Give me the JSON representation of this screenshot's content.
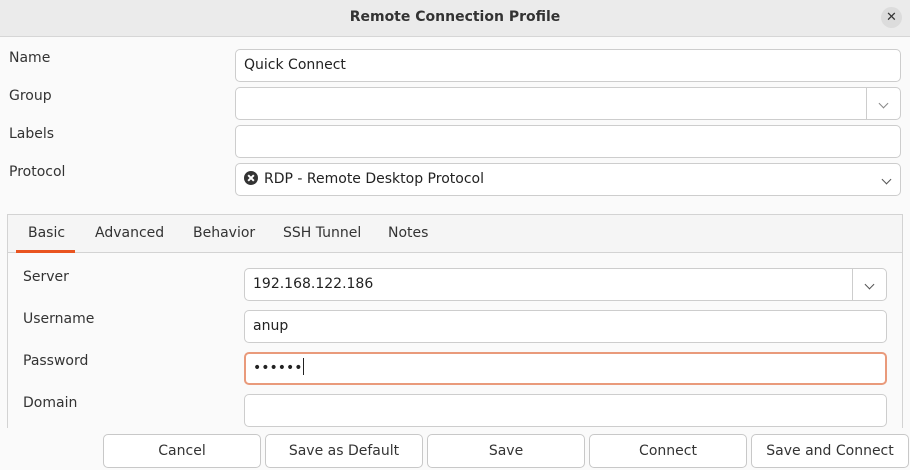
{
  "window": {
    "title": "Remote Connection Profile",
    "close_glyph": "✕"
  },
  "form": {
    "name_label": "Name",
    "name_value": "Quick Connect",
    "group_label": "Group",
    "group_value": "",
    "labels_label": "Labels",
    "labels_value": "",
    "protocol_label": "Protocol",
    "protocol_value": "RDP - Remote Desktop Protocol"
  },
  "tabs": [
    "Basic",
    "Advanced",
    "Behavior",
    "SSH Tunnel",
    "Notes"
  ],
  "basic": {
    "server_label": "Server",
    "server_value": "192.168.122.186",
    "username_label": "Username",
    "username_value": "anup",
    "password_label": "Password",
    "password_value": "••••••",
    "domain_label": "Domain",
    "domain_value": ""
  },
  "buttons": {
    "cancel": "Cancel",
    "save_default": "Save as Default",
    "save": "Save",
    "connect": "Connect",
    "save_connect": "Save and Connect"
  },
  "colors": {
    "accent": "#e95420",
    "focus_border": "#e99a7b"
  }
}
